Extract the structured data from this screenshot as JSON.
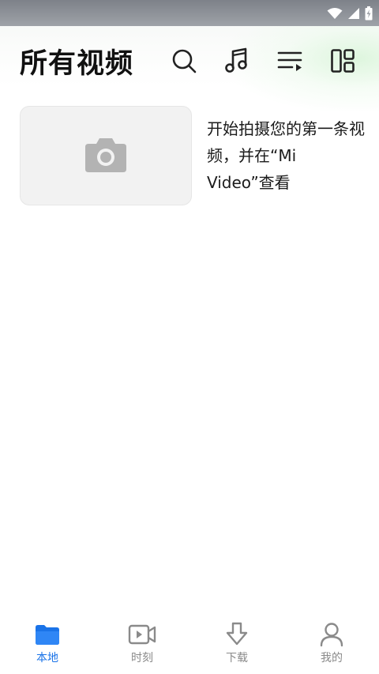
{
  "header": {
    "title": "所有视频"
  },
  "empty_state": {
    "message": "开始拍摄您的第一条视频，并在“Mi Video”查看"
  },
  "bottom_nav": {
    "items": [
      {
        "label": "本地",
        "icon": "folder-icon",
        "active": true
      },
      {
        "label": "时刻",
        "icon": "video-clip-icon",
        "active": false
      },
      {
        "label": "下载",
        "icon": "download-icon",
        "active": false
      },
      {
        "label": "我的",
        "icon": "person-icon",
        "active": false
      }
    ]
  },
  "colors": {
    "accent": "#1a73e8",
    "inactive": "#8a8a8a",
    "title": "#111111",
    "status_bar": "#8e9198"
  }
}
